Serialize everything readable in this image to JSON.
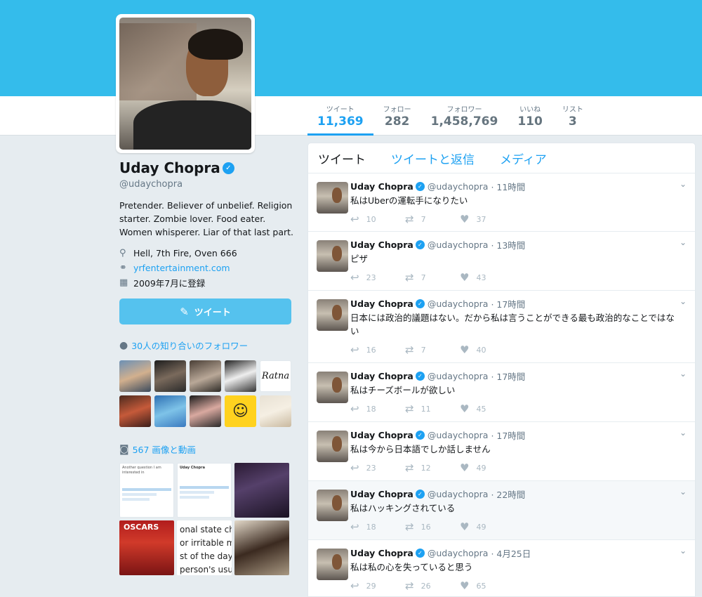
{
  "profile": {
    "name": "Uday Chopra",
    "handle": "@udaychopra",
    "bio": "Pretender. Believer of unbelief. Religion starter. Zombie lover. Food eater. Women whisperer. Liar of that last part.",
    "location": "Hell, 7th Fire, Oven 666",
    "website": "yrfentertainment.com",
    "joined": "2009年7月に登録",
    "tweet_button": "ツイート"
  },
  "stats": [
    {
      "label": "ツイート",
      "value": "11,369"
    },
    {
      "label": "フォロー",
      "value": "282"
    },
    {
      "label": "フォロワー",
      "value": "1,458,769"
    },
    {
      "label": "いいね",
      "value": "110"
    },
    {
      "label": "リスト",
      "value": "3"
    }
  ],
  "followers_section": {
    "title": "30人の知り合いのフォロワー",
    "badge_text": "Ratna"
  },
  "media_section": {
    "title": "567 画像と動画",
    "snippets": [
      "Another question I am interested in",
      "Uday Chopra",
      "onal state chara",
      "or irritable moo",
      "st of the day ne",
      "person's usual",
      "OSCARS"
    ]
  },
  "timeline": {
    "tabs": [
      "ツイート",
      "ツイートと返信",
      "メディア"
    ],
    "tweets": [
      {
        "name": "Uday Chopra",
        "handle": "@udaychopra",
        "time": "· 11時間",
        "text": "私はUberの運転手になりたい",
        "replies": "10",
        "retweets": "7",
        "likes": "37"
      },
      {
        "name": "Uday Chopra",
        "handle": "@udaychopra",
        "time": "· 13時間",
        "text": "ピザ",
        "replies": "23",
        "retweets": "7",
        "likes": "43"
      },
      {
        "name": "Uday Chopra",
        "handle": "@udaychopra",
        "time": "· 17時間",
        "text": "日本には政治的議題はない。だから私は言うことができる最も政治的なことではない",
        "replies": "16",
        "retweets": "7",
        "likes": "40"
      },
      {
        "name": "Uday Chopra",
        "handle": "@udaychopra",
        "time": "· 17時間",
        "text": "私はチーズボールが欲しい",
        "replies": "18",
        "retweets": "11",
        "likes": "45"
      },
      {
        "name": "Uday Chopra",
        "handle": "@udaychopra",
        "time": "· 17時間",
        "text": "私は今から日本語でしか話しません",
        "replies": "23",
        "retweets": "12",
        "likes": "49"
      },
      {
        "name": "Uday Chopra",
        "handle": "@udaychopra",
        "time": "· 22時間",
        "text": "私はハッキングされている",
        "replies": "18",
        "retweets": "16",
        "likes": "49"
      },
      {
        "name": "Uday Chopra",
        "handle": "@udaychopra",
        "time": "· 4月25日",
        "text": "私は私の心を失っていると思う",
        "replies": "29",
        "retweets": "26",
        "likes": "65"
      }
    ]
  },
  "icons": {
    "location": "map-pin-icon",
    "link": "link-icon",
    "calendar": "calendar-icon",
    "compose": "compose-icon",
    "person": "person-icon",
    "camera": "camera-icon",
    "reply": "reply-icon",
    "retweet": "retweet-icon",
    "like": "heart-icon",
    "caret": "chevron-down-icon"
  },
  "colors": {
    "banner": "#34bceb",
    "accent": "#1da1f2",
    "tweet_button": "#55c2ee"
  }
}
